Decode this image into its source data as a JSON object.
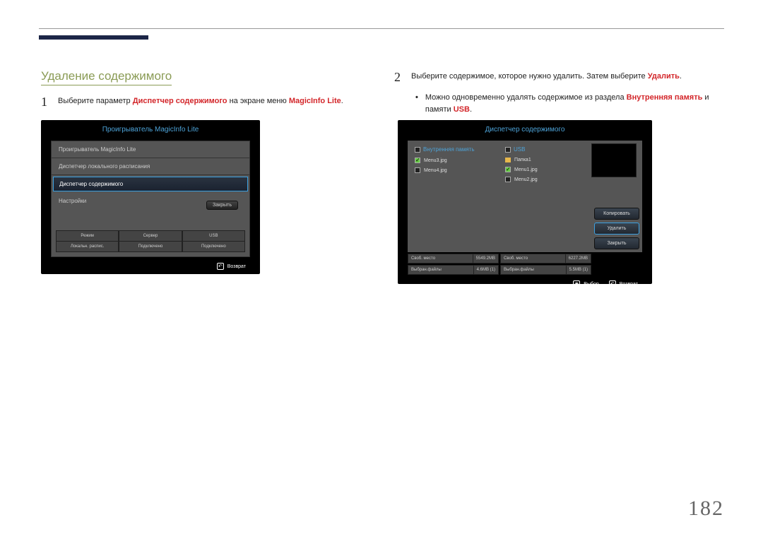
{
  "section_title": "Удаление содержимого",
  "left": {
    "step_num": "1",
    "step_text_parts": [
      "Выберите параметр ",
      "Диспетчер содержимого",
      " на экране меню ",
      "MagicInfo Lite",
      "."
    ]
  },
  "right": {
    "step_num": "2",
    "step_text_parts": [
      "Выберите содержимое, которое нужно удалить. Затем выберите ",
      "Удалить",
      "."
    ],
    "bullet_parts": [
      "Можно одновременно удалять содержимое из раздела ",
      "Внутренняя память",
      " и памяти ",
      "USB",
      "."
    ]
  },
  "panel1": {
    "title": "Проигрыватель MagicInfo Lite",
    "items": [
      {
        "label": "Проигрыватель MagicInfo Lite"
      },
      {
        "label": "Диспетчер локального расписания"
      },
      {
        "label": "Диспетчер содержимого",
        "selected": true
      },
      {
        "label": "Настройки",
        "close": "Закрыть"
      }
    ],
    "status": [
      {
        "label": "Режим",
        "val": "Локальн. распис."
      },
      {
        "label": "Сервер",
        "val": "Подключено"
      },
      {
        "label": "USB",
        "val": "Подключено"
      }
    ],
    "footer_return": "Возврат"
  },
  "panel2": {
    "title": "Диспетчер содержимого",
    "left_head": "Внутренняя память",
    "right_head": "USB",
    "left_files": [
      {
        "name": "Menu3.jpg",
        "checked": true
      },
      {
        "name": "Menu4.jpg",
        "checked": false
      }
    ],
    "right_files": [
      {
        "name": "Папка1",
        "folder": true
      },
      {
        "name": "Menu1.jpg",
        "checked": true
      },
      {
        "name": "Menu2.jpg",
        "checked": false
      }
    ],
    "buttons": {
      "copy": "Копировать",
      "delete": "Удалить",
      "close": "Закрыть"
    },
    "stats_row1": [
      {
        "lbl": "Своб. место",
        "val": "5549.2MB"
      },
      {
        "lbl": "Своб. место",
        "val": "6227.2MB"
      }
    ],
    "stats_row2": [
      {
        "lbl": "Выбран.файлы",
        "val": "4.6MB (1)"
      },
      {
        "lbl": "Выбран.файлы",
        "val": "5.5MB (1)"
      }
    ],
    "footer_select": "Выбор",
    "footer_return": "Возврат"
  },
  "page_number": "182"
}
